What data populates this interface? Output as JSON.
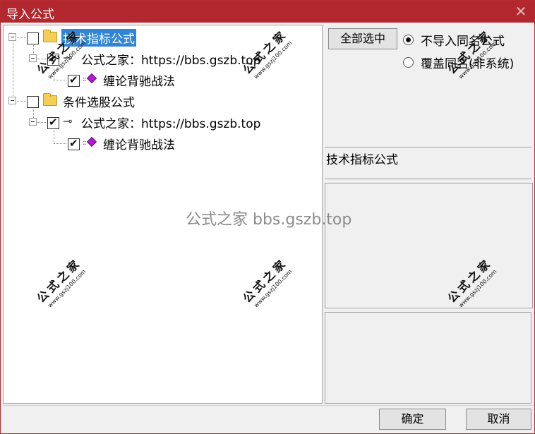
{
  "window": {
    "title": "导入公式",
    "close_glyph": "✕"
  },
  "tree": {
    "groups": [
      {
        "label": "技术指标公式",
        "checked": false,
        "selected": true,
        "source": {
          "label": "公式之家：https://bbs.gszb.top",
          "checked": true
        },
        "formula": {
          "label": "缠论背驰战法",
          "checked": true
        }
      },
      {
        "label": "条件选股公式",
        "checked": false,
        "selected": false,
        "source": {
          "label": "公式之家：https://bbs.gszb.top",
          "checked": true
        },
        "formula": {
          "label": "缠论背驰战法",
          "checked": true
        }
      }
    ]
  },
  "options": {
    "select_all_label": "全部选中",
    "radio_skip_label": "不导入同名公式",
    "radio_overwrite_label": "覆盖同名(非系统)",
    "radio_selected": "skip"
  },
  "description": {
    "text": "技术指标公式"
  },
  "buttons": {
    "ok_label": "确定",
    "cancel_label": "取消"
  },
  "watermarks": {
    "center_text": "公式之家 bbs.gszb.top",
    "stamp_big": "公式之家",
    "stamp_small": "www.gszj100.com"
  },
  "colors": {
    "titlebar": "#b3282f",
    "selection": "#3285d6",
    "gem": "#b21bcf",
    "folder": "#f4cf58"
  }
}
